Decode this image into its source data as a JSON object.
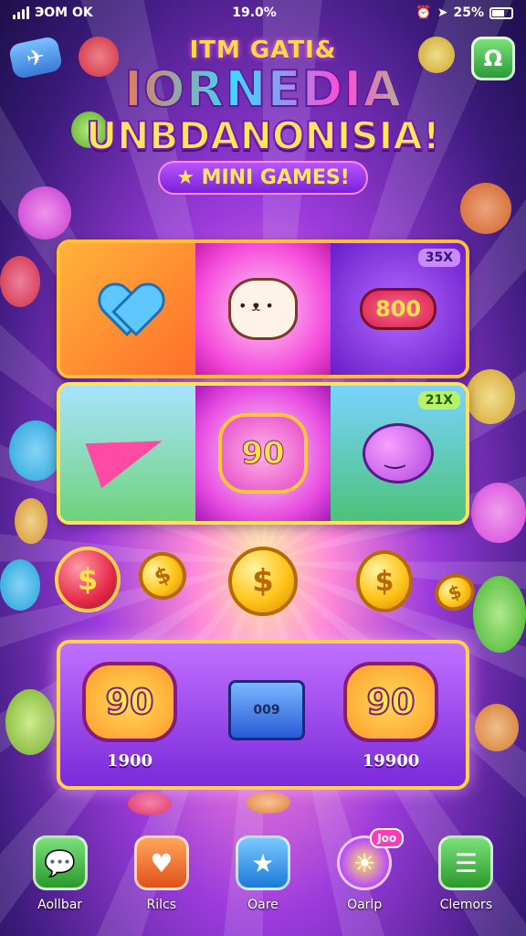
{
  "status": {
    "network": "ЭОМ OK",
    "time": "19.0%",
    "battery_pct": "25%"
  },
  "header": {
    "line1": "ITM GATI&",
    "line2": "IORNEDIA",
    "line3": "UNBDANONISIA!",
    "line4": "★ MINI GAMES!"
  },
  "games": {
    "row1": [
      {
        "name": "heart-game",
        "icon": "heart-icon"
      },
      {
        "name": "cat-game",
        "icon": "cat-icon"
      },
      {
        "name": "bomb-game",
        "icon": "bomb-icon",
        "label": "800",
        "badge": "35X"
      }
    ],
    "row2": [
      {
        "name": "plane-game",
        "icon": "paper-plane-icon"
      },
      {
        "name": "heart-90-game",
        "icon": "heart-icon",
        "label": "90"
      },
      {
        "name": "blob-game",
        "icon": "monster-icon",
        "badge": "21X"
      }
    ]
  },
  "rewards": [
    {
      "label": "90",
      "value": "1900"
    },
    {
      "label": "009",
      "value": ""
    },
    {
      "label": "90",
      "value": "19900"
    }
  ],
  "nav": [
    {
      "label": "Aollbar",
      "icon": "chat-icon",
      "color": "#4ad04a"
    },
    {
      "label": "Rilcs",
      "icon": "heart-icon",
      "color": "#ff7a2a"
    },
    {
      "label": "Oare",
      "icon": "star-icon",
      "color": "#3aa8ff"
    },
    {
      "label": "Oarlp",
      "icon": "sun-icon",
      "color": "#b84aff",
      "badge": "Joo"
    },
    {
      "label": "Clemors",
      "icon": "menu-icon",
      "color": "#4ad04a"
    }
  ],
  "coins": {
    "symbol": "$"
  }
}
